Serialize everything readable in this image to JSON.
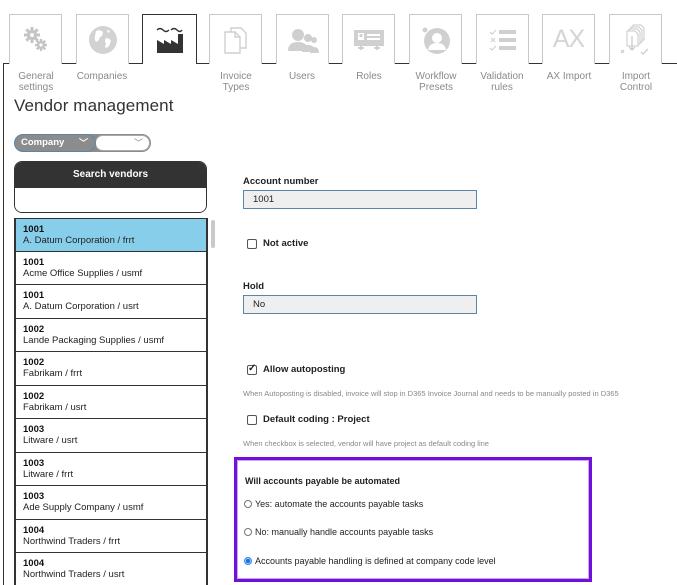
{
  "nav": {
    "tabs": [
      {
        "id": "general-settings",
        "label": "General settings",
        "icon": "gears-icon",
        "active": false
      },
      {
        "id": "companies",
        "label": "Companies",
        "icon": "globe-icon",
        "active": false
      },
      {
        "id": "vendor-management",
        "label": "",
        "icon": "factory-icon",
        "active": true
      },
      {
        "id": "invoice-types",
        "label": "Invoice Types",
        "icon": "documents-icon",
        "active": false
      },
      {
        "id": "users",
        "label": "Users",
        "icon": "users-icon",
        "active": false
      },
      {
        "id": "roles",
        "label": "Roles",
        "icon": "id-card-icon",
        "active": false
      },
      {
        "id": "workflow-presets",
        "label": "Workflow Presets",
        "icon": "user-circle-icon",
        "active": false
      },
      {
        "id": "validation-rules",
        "label": "Validation rules",
        "icon": "checklist-icon",
        "active": false
      },
      {
        "id": "ax-import",
        "label": "AX Import",
        "icon": "ax-icon",
        "active": false
      },
      {
        "id": "import-control",
        "label": "Import Control",
        "icon": "import-stack-icon",
        "active": false
      }
    ],
    "labels": {
      "general_1": "General",
      "general_2": "settings",
      "companies": "Companies",
      "invoice_1": "Invoice",
      "invoice_2": "Types",
      "users": "Users",
      "roles": "Roles",
      "workflow_1": "Workflow",
      "workflow_2": "Presets",
      "validation_1": "Validation",
      "validation_2": "rules",
      "ax_import": "AX Import",
      "import_1": "Import",
      "import_2": "Control",
      "ax_glyph": "AX"
    }
  },
  "page": {
    "title": "Vendor management"
  },
  "filter": {
    "selected": "Company",
    "second_value": ""
  },
  "search": {
    "header": "Search vendors",
    "value": "",
    "placeholder": ""
  },
  "vendors": [
    {
      "code": "1001",
      "name": "A. Datum Corporation / frrt",
      "selected": true
    },
    {
      "code": "1001",
      "name": "Acme Office Supplies / usmf",
      "selected": false
    },
    {
      "code": "1001",
      "name": "A. Datum Corporation / usrt",
      "selected": false
    },
    {
      "code": "1002",
      "name": "Lande Packaging Supplies / usmf",
      "selected": false
    },
    {
      "code": "1002",
      "name": "Fabrikam / frrt",
      "selected": false
    },
    {
      "code": "1002",
      "name": "Fabrikam / usrt",
      "selected": false
    },
    {
      "code": "1003",
      "name": "Litware / usrt",
      "selected": false
    },
    {
      "code": "1003",
      "name": "Litware / frrt",
      "selected": false
    },
    {
      "code": "1003",
      "name": "Ade Supply Company / usmf",
      "selected": false
    },
    {
      "code": "1004",
      "name": "Northwind Traders / frrt",
      "selected": false
    },
    {
      "code": "1004",
      "name": "Northwind Traders / usrt",
      "selected": false
    }
  ],
  "form": {
    "account_number_label": "Account number",
    "account_number_value": "1001",
    "not_active_label": "Not active",
    "not_active_checked": false,
    "hold_label": "Hold",
    "hold_value": "No",
    "allow_autoposting_label": "Allow autoposting",
    "allow_autoposting_checked": true,
    "autoposting_hint": "When Autoposting is disabled, invoice will stop in D365 Invoice Journal and needs to be manually posted in D365",
    "default_coding_label": "Default coding : Project",
    "default_coding_checked": false,
    "default_coding_hint": "When checkbox is selected, vendor will have project as default coding line"
  },
  "ap_automation": {
    "title": "Will accounts payable be automated",
    "options": [
      {
        "label": "Yes: automate the accounts payable tasks",
        "selected": false
      },
      {
        "label": "No: manually handle accounts payable tasks",
        "selected": false
      },
      {
        "label": "Accounts payable handling is defined at company code level",
        "selected": true
      }
    ],
    "highlight_color": "#7010d8"
  },
  "colors": {
    "selected_row": "#87ceeb",
    "header_dark": "#333333",
    "input_border": "#5a86a8"
  }
}
